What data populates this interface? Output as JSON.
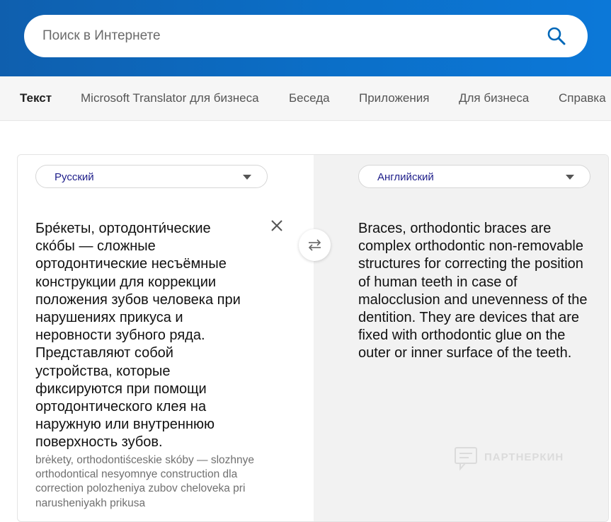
{
  "search": {
    "placeholder": "Поиск в Интернете"
  },
  "nav": {
    "items": [
      {
        "label": "Текст",
        "active": true
      },
      {
        "label": "Microsoft Translator для бизнеса"
      },
      {
        "label": "Беседа"
      },
      {
        "label": "Приложения"
      },
      {
        "label": "Для бизнеса"
      },
      {
        "label": "Справка"
      }
    ]
  },
  "source": {
    "language": "Русский",
    "text": "Бре́кеты, ортодонти́ческие ско́бы — сложные ортодонтические несъёмные конструкции для коррекции положения зубов человека при нарушениях прикуса и неровности зубного ряда. Представляют собой устройства, которые фиксируются при помощи ортодонтического клея на наружную или внутреннюю поверхность зубов.",
    "transliteration": "brėkety, orthodontiśceskie skóby — slozhnye orthodontical nesyomnye construction dla correction polozheniya zubov cheloveka pri narusheniyakh prikusa"
  },
  "target": {
    "language": "Английский",
    "text": "Braces, orthodontic braces are complex orthodontic non-removable structures for correcting the position of human teeth in case of malocclusion and unevenness of the dentition. They are devices that are fixed with orthodontic glue on the outer or inner surface of the teeth."
  },
  "watermark": {
    "text": "ПАРТНЕРКИН"
  },
  "colors": {
    "header": "#0b6fc8",
    "accent": "#0067b8",
    "lang_text": "#1e1e8a"
  }
}
